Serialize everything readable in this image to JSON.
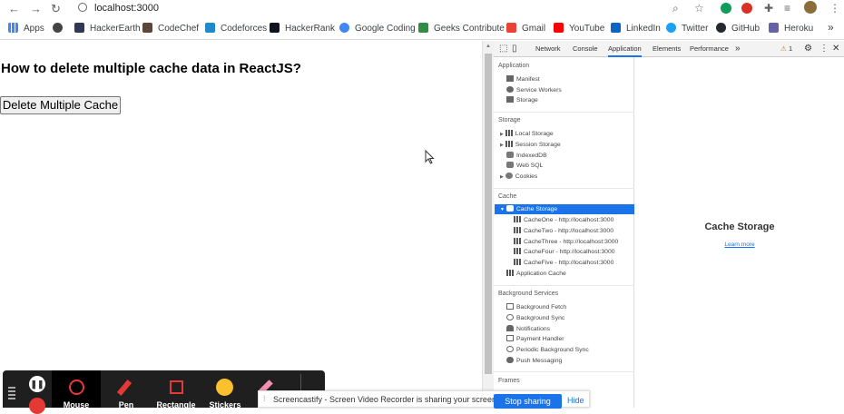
{
  "browser": {
    "url": "localhost:3000",
    "bookmarks": [
      {
        "label": "Apps",
        "color": "#4285f4"
      },
      {
        "label": "",
        "color": "#444444"
      },
      {
        "label": "HackerEarth",
        "color": "#323754"
      },
      {
        "label": "CodeChef",
        "color": "#5b4638"
      },
      {
        "label": "Codeforces",
        "color": "#1f8acb"
      },
      {
        "label": "HackerRank",
        "color": "#0e141e"
      },
      {
        "label": "Google Coding",
        "color": "#4285f4"
      },
      {
        "label": "Geeks Contribute",
        "color": "#2f8d46"
      },
      {
        "label": "Gmail",
        "color": "#ea4335"
      },
      {
        "label": "YouTube",
        "color": "#ff0000"
      },
      {
        "label": "LinkedIn",
        "color": "#0a66c2"
      },
      {
        "label": "Twitter",
        "color": "#1da1f2"
      },
      {
        "label": "GitHub",
        "color": "#24292e"
      },
      {
        "label": "Heroku",
        "color": "#6762a6"
      }
    ],
    "more": "»"
  },
  "page": {
    "heading": "How to delete multiple cache data in ReactJS?",
    "button_label": "Delete Multiple Cache"
  },
  "devtools": {
    "tabs": [
      "Network",
      "Console",
      "Application",
      "Elements",
      "Performance"
    ],
    "overflow": "»",
    "warning_count": "1",
    "sections": {
      "application": {
        "header": "Application",
        "items": [
          "Manifest",
          "Service Workers",
          "Storage"
        ]
      },
      "storage": {
        "header": "Storage",
        "items": [
          "Local Storage",
          "Session Storage",
          "IndexedDB",
          "Web SQL",
          "Cookies"
        ]
      },
      "cache": {
        "header": "Cache",
        "selected": "Cache Storage",
        "entries": [
          "CacheOne - http://localhost:3000",
          "CacheTwo - http://localhost:3000",
          "CacheThree - http://localhost:3000",
          "CacheFour - http://localhost:3000",
          "CacheFive - http://localhost:3000"
        ],
        "app_cache": "Application Cache"
      },
      "background": {
        "header": "Background Services",
        "items": [
          "Background Fetch",
          "Background Sync",
          "Notifications",
          "Payment Handler",
          "Periodic Background Sync",
          "Push Messaging"
        ]
      },
      "frames": {
        "header": "Frames"
      }
    },
    "main_title": "Cache Storage",
    "learn_more": "Learn more"
  },
  "screencastify": {
    "tools": [
      "Mouse",
      "Pen",
      "Rectangle",
      "Stickers"
    ],
    "message": "Screencastify - Screen Video Recorder is sharing your screen.",
    "stop_label": "Stop sharing",
    "hide_label": "Hide"
  },
  "colors": {
    "accent": "#1a73e8",
    "selected_row": "#1a73e8"
  }
}
